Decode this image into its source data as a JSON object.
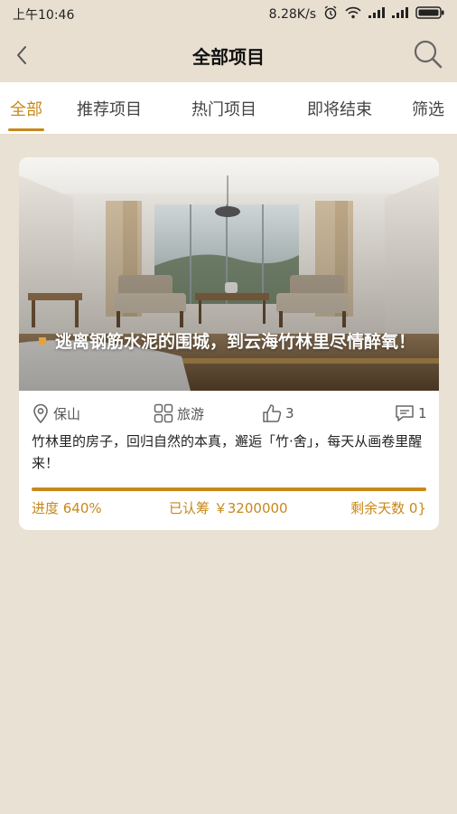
{
  "status_bar": {
    "time": "上午10:46",
    "network_speed": "8.28K/s",
    "icons": [
      "alarm-icon",
      "wifi-icon",
      "signal-icon",
      "signal-icon",
      "battery-icon"
    ]
  },
  "nav": {
    "title": "全部项目",
    "back_icon": "chevron-left-icon",
    "search_icon": "search-icon"
  },
  "tabs": [
    {
      "label": "全部",
      "active": true
    },
    {
      "label": "推荐项目",
      "active": false
    },
    {
      "label": "热门项目",
      "active": false
    },
    {
      "label": "即将结束",
      "active": false
    },
    {
      "label": "筛选",
      "active": false
    }
  ],
  "project": {
    "title": "逃离钢筋水泥的围城，到云海竹林里尽情醉氧！",
    "location": "保山",
    "category": "旅游",
    "likes": "3",
    "comments": "1",
    "description": "竹林里的房子，回归自然的本真，邂逅「竹·舍」，每天从画卷里醒来！",
    "progress_label": "进度 640%",
    "progress_fraction": 1.0,
    "raised_label": "已认筹 ￥3200000",
    "days_left_label": "剩余天数 0}"
  },
  "colors": {
    "accent": "#c8881a",
    "background": "#e9e1d3",
    "card": "#ffffff"
  }
}
